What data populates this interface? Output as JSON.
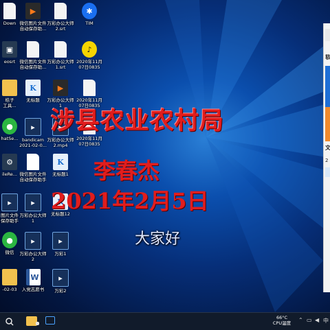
{
  "desktop": {
    "icons": [
      {
        "label": "Down",
        "kind": "file",
        "glyph": ""
      },
      {
        "label": "微信图片文件\n自动保存助...",
        "kind": "video",
        "glyph": "▶"
      },
      {
        "label": "万彩办公大师\n2.srt",
        "kind": "file",
        "glyph": ""
      },
      {
        "label": "TIM",
        "kind": "tim",
        "glyph": "✱"
      },
      {
        "label": "eosrt",
        "kind": "app",
        "glyph": "▣"
      },
      {
        "label": "微信图片文件\n自动保存助...",
        "kind": "file",
        "glyph": ""
      },
      {
        "label": "万彩办公大师\n1.srt",
        "kind": "file",
        "glyph": ""
      },
      {
        "label": "2020年11月\n07日0835",
        "kind": "music",
        "glyph": "♪"
      },
      {
        "label": "桔子\n工具...",
        "kind": "folder",
        "glyph": ""
      },
      {
        "label": "无标题",
        "kind": "k",
        "glyph": "K"
      },
      {
        "label": "万彩办公大师\n1",
        "kind": "video",
        "glyph": "▶"
      },
      {
        "label": "2020年11月\n07日0835",
        "kind": "file",
        "glyph": ""
      },
      {
        "label": "hatSe...",
        "kind": "wechat",
        "glyph": "●"
      },
      {
        "label": "bandicam\n2021-02-0...",
        "kind": "mp4",
        "glyph": "▸"
      },
      {
        "label": "万彩办公大师\n2.mp4",
        "kind": "mp4",
        "glyph": "▸"
      },
      {
        "label": "2020年11月\n07日0835",
        "kind": "file",
        "glyph": ""
      },
      {
        "label": "ileRe...",
        "kind": "app",
        "glyph": "⚙"
      },
      {
        "label": "微信图片文件\n自动保存助手",
        "kind": "blank",
        "glyph": ""
      },
      {
        "label": "无标题1",
        "kind": "k",
        "glyph": "K"
      },
      {
        "label": "",
        "kind": "none",
        "glyph": ""
      },
      {
        "label": "图片文件\n保存助手",
        "kind": "mp4",
        "glyph": "▸"
      },
      {
        "label": "万彩办公大师\n1",
        "kind": "mp4",
        "glyph": "▸"
      },
      {
        "label": "无标题12",
        "kind": "k",
        "glyph": "K"
      },
      {
        "label": "",
        "kind": "none",
        "glyph": ""
      },
      {
        "label": "微信",
        "kind": "wechat",
        "glyph": "●"
      },
      {
        "label": "万彩办公大师\n2",
        "kind": "mp4",
        "glyph": "▸"
      },
      {
        "label": "万彩1",
        "kind": "mp4",
        "glyph": "▸"
      },
      {
        "label": "",
        "kind": "none",
        "glyph": ""
      },
      {
        "label": "-02-03",
        "kind": "folder",
        "glyph": ""
      },
      {
        "label": "入党志愿书",
        "kind": "docx",
        "glyph": "W"
      },
      {
        "label": "万彩2",
        "kind": "mp4",
        "glyph": "▸"
      },
      {
        "label": "",
        "kind": "none",
        "glyph": ""
      }
    ]
  },
  "overlay": {
    "title": "涉县农业农村局",
    "name": "李春杰",
    "date": "2021年2月5日",
    "greeting": "大家好"
  },
  "side_panel": {
    "items": [
      "软",
      "文",
      "2"
    ]
  },
  "taskbar": {
    "temperature": "66°C",
    "temperature_label": "CPU温度"
  },
  "colors": {
    "overlay_text": "#e11d1d",
    "taskbar": "#111b2b",
    "wallpaper": "#0b4fae"
  }
}
